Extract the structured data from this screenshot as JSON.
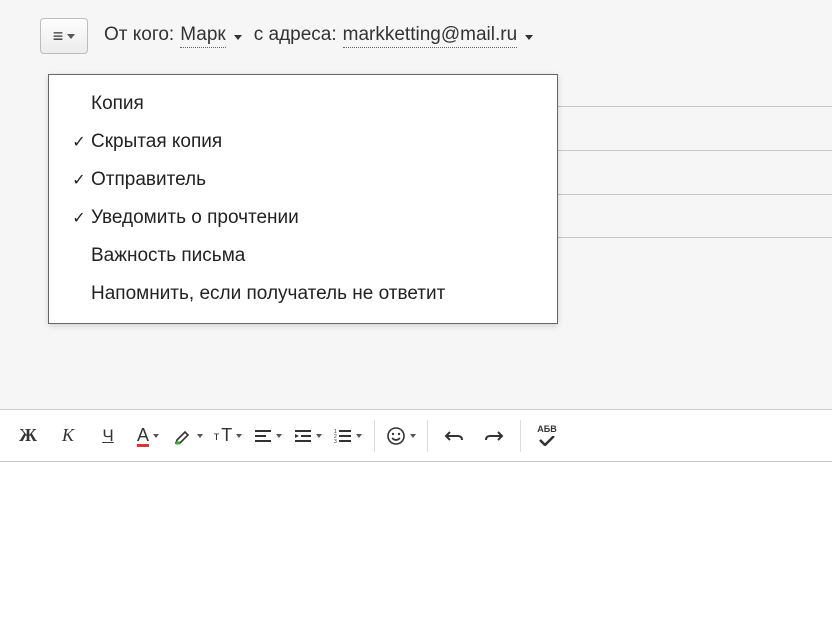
{
  "header": {
    "from_label": "От кого:",
    "sender_name": "Марк",
    "address_label": "с адреса:",
    "sender_email": "markketting@mail.ru"
  },
  "menu": {
    "items": [
      {
        "label": "Копия",
        "checked": false
      },
      {
        "label": "Скрытая копия",
        "checked": true
      },
      {
        "label": "Отправитель",
        "checked": true
      },
      {
        "label": "Уведомить о прочтении",
        "checked": true
      },
      {
        "label": "Важность письма",
        "checked": false
      },
      {
        "label": "Напомнить, если получатель не ответит",
        "checked": false
      }
    ]
  },
  "toolbar": {
    "bold": "Ж",
    "italic": "К",
    "underline": "Ч",
    "text_color": "А",
    "font_size_small": "т",
    "font_size_big": "Т",
    "spellcheck": "АБВ"
  }
}
